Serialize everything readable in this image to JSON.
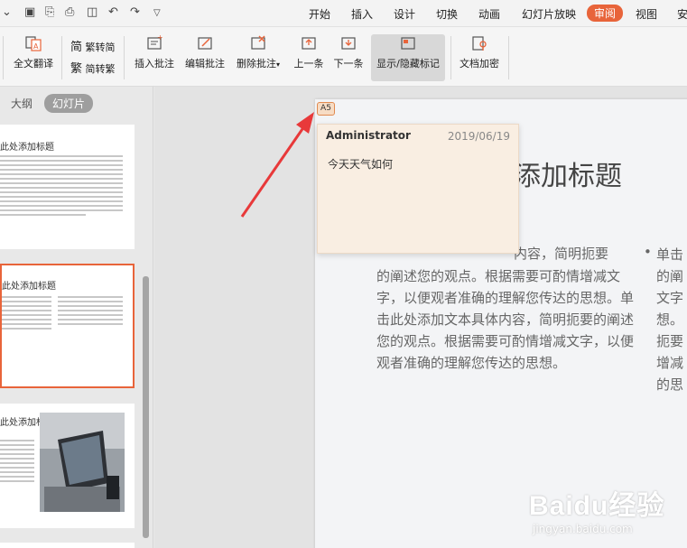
{
  "menubar": {
    "tabs": [
      "开始",
      "插入",
      "设计",
      "切换",
      "动画",
      "幻灯片放映",
      "审阅",
      "视图",
      "安"
    ],
    "active_tab": "审阅"
  },
  "ribbon": {
    "full_translate": "全文翻译",
    "trad_simp": "繁转简",
    "simp_trad": "简转繁",
    "insert_comment": "插入批注",
    "edit_comment": "编辑批注",
    "delete_comment": "删除批注",
    "prev": "上一条",
    "next": "下一条",
    "show_hide": "显示/隐藏标记",
    "encrypt": "文档加密"
  },
  "leftpanel": {
    "tab_outline": "大纲",
    "tab_slides": "幻灯片",
    "thumb1_title": "此处添加标题",
    "thumb2_title": "此处添加标题",
    "thumb3_title": "此处添加标"
  },
  "slide": {
    "title": "添加标题",
    "body": "的阐述您的观点。根据需要可酌情增减文字，以便观者准确的理解您传达的思想。单击此处添加文本具体内容，简明扼要的阐述您的观点。根据需要可酌情增减文字，以便观者准确的理解您传达的思想。",
    "body_first_line": "内容，简明扼要",
    "col2_lines": [
      "单击",
      "的阐",
      "文字",
      "想。",
      "扼要",
      "增减",
      "的思"
    ]
  },
  "comment": {
    "marker": "A5",
    "author": "Administrator",
    "date": "2019/06/19",
    "text": "今天天气如何"
  },
  "watermark": {
    "brand": "Baidu经验",
    "url": "jingyan.baidu.com"
  },
  "colors": {
    "accent": "#e8643a",
    "arrow": "#e8393a",
    "popup_bg": "#f9eee2"
  }
}
